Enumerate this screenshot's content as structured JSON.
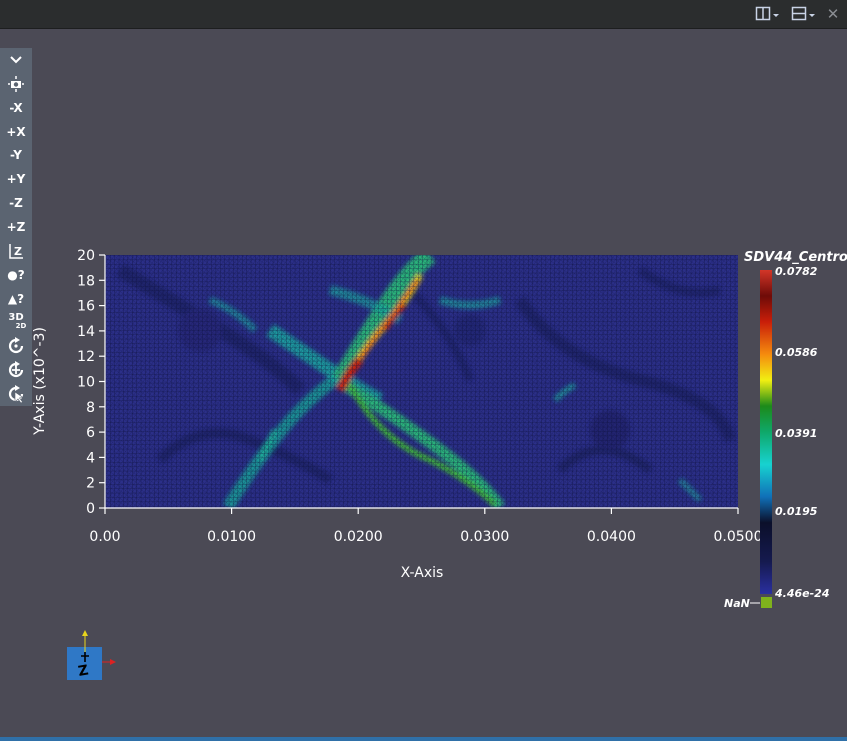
{
  "toolbar": {
    "items": [
      {
        "icon": "chevron-down-icon"
      },
      {
        "icon": "camera-reset-icon"
      },
      {
        "label": "-X"
      },
      {
        "label": "+X"
      },
      {
        "label": "-Y"
      },
      {
        "label": "+Y"
      },
      {
        "label": "-Z"
      },
      {
        "label": "+Z"
      },
      {
        "icon": "axis-z-icon"
      },
      {
        "label": "●?"
      },
      {
        "label": "▲?"
      },
      {
        "label": "3D",
        "sub": "2D"
      },
      {
        "icon": "rotate-icon"
      },
      {
        "icon": "rotate-center-icon"
      },
      {
        "icon": "pick-center-icon"
      }
    ]
  },
  "plot": {
    "x_axis_label": "X-Axis",
    "y_axis_label": "Y-Axis (x10^-3)",
    "x_ticks": [
      "0.00",
      "0.0100",
      "0.0200",
      "0.0300",
      "0.0400",
      "0.0500"
    ],
    "y_ticks": [
      "0",
      "2",
      "4",
      "6",
      "8",
      "10",
      "12",
      "14",
      "16",
      "18",
      "20"
    ]
  },
  "colorbar": {
    "title": "SDV44_Centro",
    "labels": [
      "0.0782",
      "0.0586",
      "0.0391",
      "0.0195",
      "4.46e-24"
    ],
    "nan_label": "NaN",
    "nan_color": "#7fb21c"
  },
  "orientation": {
    "label": "Z"
  },
  "colors": {
    "background": "#4b4a55",
    "field_base": "#2a2e86",
    "accent_bar": "#2f70a8"
  }
}
